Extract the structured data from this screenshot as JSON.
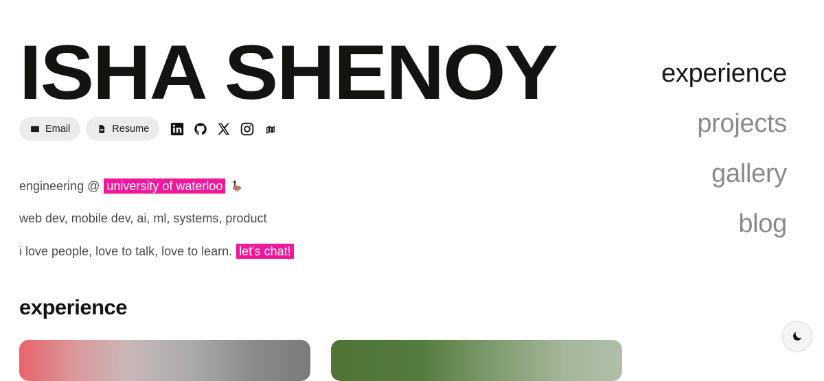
{
  "header": {
    "name": "ISHA SHENOY",
    "buttons": {
      "email_label": "Email",
      "resume_label": "Resume"
    },
    "social_icons": [
      "linkedin-icon",
      "github-icon",
      "x-icon",
      "instagram-icon",
      "goodreads-icon"
    ]
  },
  "intro": {
    "line1_text": "engineering @",
    "line1_highlight": "university of waterloo",
    "line2_text": "web dev, mobile dev, ai, ml, systems, product",
    "line3_text": "i love people, love to talk, love to learn.",
    "line3_highlight": "let's chat!"
  },
  "section": {
    "title": "experience"
  },
  "nav": {
    "items": [
      {
        "label": "experience",
        "active": true
      },
      {
        "label": "projects",
        "active": false
      },
      {
        "label": "gallery",
        "active": false
      },
      {
        "label": "blog",
        "active": false
      }
    ]
  },
  "colors": {
    "highlight": "#f0179b",
    "text_dark": "#15130f",
    "text_body": "#4d4a45",
    "nav_inactive": "#8a8a8a",
    "pill_bg": "#ececec"
  },
  "theme_toggle": {
    "icon": "moon-icon"
  }
}
